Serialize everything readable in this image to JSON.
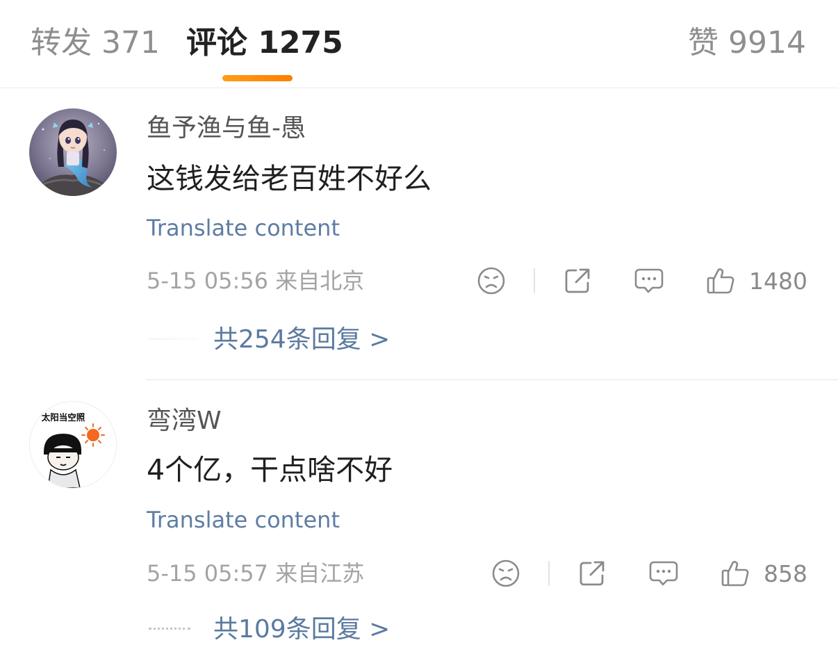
{
  "tabs": {
    "repost": "转发 371",
    "comment": "评论 1275",
    "like": "赞 9914"
  },
  "comments": [
    {
      "username": "鱼予渔与鱼-愚",
      "text": "这钱发给老百姓不好么",
      "translate": "Translate content",
      "meta": "5-15 05:56  来自北京",
      "likes": "1480",
      "replies": "共254条回复 >",
      "avatar_icon": "mermaid-girl-avatar"
    },
    {
      "username": "弯湾W",
      "text": "4个亿，干点啥不好",
      "translate": "Translate content",
      "meta": "5-15 05:57  来自江苏",
      "likes": "858",
      "replies": "共109条回复 >",
      "avatar_icon": "sunbathing-cartoon-avatar",
      "avatar_text": "太阳当空照"
    }
  ],
  "colors": {
    "accent": "#ff8a00",
    "link": "#5b7aa0",
    "muted": "#a3a3a3"
  },
  "icons": [
    "frown-face-icon",
    "share-icon",
    "comment-icon",
    "thumbs-up-icon"
  ]
}
